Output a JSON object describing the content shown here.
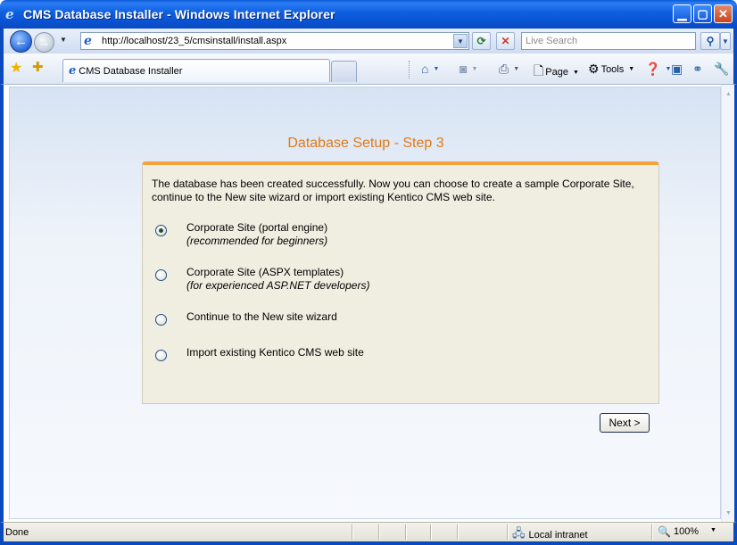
{
  "window": {
    "title": "CMS Database Installer - Windows Internet Explorer",
    "app_icon": "ie-logo-icon",
    "minimize": "▁",
    "maximize": "▢",
    "close": "✕"
  },
  "address_bar": {
    "url": "http://localhost/23_5/cmsinstall/install.aspx",
    "search_placeholder": "Live Search"
  },
  "tabs": [
    {
      "label": "CMS Database Installer",
      "active": true
    }
  ],
  "command_bar": {
    "page_label": "Page",
    "tools_label": "Tools"
  },
  "main": {
    "heading": "Database Setup - Step 3",
    "intro": "The database has been created successfully. Now you can choose to create a sample Corporate Site, continue to the New site wizard or import existing Kentico CMS web site.",
    "options": [
      {
        "label": "Corporate Site (portal engine)",
        "sub": "(recommended for beginners)",
        "checked": true
      },
      {
        "label": "Corporate Site (ASPX templates)",
        "sub": "(for experienced ASP.NET developers)",
        "checked": false
      },
      {
        "label": "Continue to the New site wizard",
        "sub": "",
        "checked": false
      },
      {
        "label": "Import existing Kentico CMS web site",
        "sub": "",
        "checked": false
      }
    ],
    "next_button": "Next >"
  },
  "status_bar": {
    "status": "Done",
    "zone": "Local intranet",
    "zoom": "100%"
  },
  "colors": {
    "heading": "#e27a14",
    "panel_bg": "#f0ede1",
    "panel_accent": "#f3a33e",
    "xp_blue": "#0a49be"
  }
}
